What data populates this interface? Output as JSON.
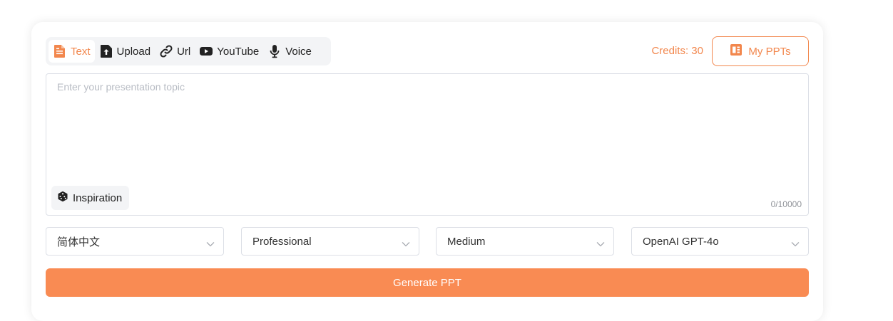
{
  "tabs": [
    {
      "label": "Text",
      "icon": "document-icon",
      "active": true
    },
    {
      "label": "Upload",
      "icon": "upload-icon",
      "active": false
    },
    {
      "label": "Url",
      "icon": "link-icon",
      "active": false
    },
    {
      "label": "YouTube",
      "icon": "youtube-icon",
      "active": false
    },
    {
      "label": "Voice",
      "icon": "microphone-icon",
      "active": false
    }
  ],
  "header": {
    "credits": "Credits: 30",
    "my_ppts_label": "My PPTs"
  },
  "topic": {
    "value": "",
    "placeholder": "Enter your presentation topic",
    "inspiration_label": "Inspiration",
    "counter": "0/10000"
  },
  "options": {
    "language": "简体中文",
    "tone": "Professional",
    "length": "Medium",
    "model": "OpenAI GPT-4o"
  },
  "generate_label": "Generate PPT",
  "colors": {
    "accent": "#f2874d",
    "button": "#f98b53"
  }
}
